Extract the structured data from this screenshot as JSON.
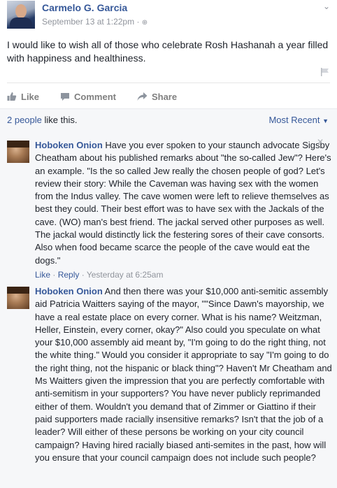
{
  "post": {
    "author": "Carmelo G. Garcia",
    "timestamp": "September 13 at 1:22pm",
    "audience_separator": "·",
    "text": "I would like to wish all of those who celebrate Rosh Hashanah a year filled with happiness and healthiness."
  },
  "actions": {
    "like": "Like",
    "comment": "Comment",
    "share": "Share"
  },
  "likes": {
    "count_text": "2 people",
    "suffix": " like this."
  },
  "sort": {
    "label": "Most Recent"
  },
  "comments": [
    {
      "author": "Hoboken Onion",
      "text": " Have you ever spoken to your staunch advocate Sigsby Cheatham about his published remarks about \"the so-called Jew\"? Here's an example. \"Is the so called Jew really the chosen people of god? Let's review their story: While the Caveman was having sex with the women from the Indus valley. The cave women were left to relieve themselves as best they could. Their best effort was to have sex with the Jackals of the cave. (WO) man's best friend. The jackal served other purposes as well. The jackal would distinctly lick the festering sores of their cave consorts. Also when food became scarce the people of the cave would eat the dogs.\"",
      "like": "Like",
      "reply": "Reply",
      "time": "Yesterday at 6:25am"
    },
    {
      "author": "Hoboken Onion",
      "text": " And then there was your $10,000 anti-semitic assembly aid Patricia Waitters saying of the mayor, \"\"Since Dawn's mayorship, we have a real estate place on every corner. What is his name? Weitzman, Heller, Einstein, every corner, okay?\" Also could you speculate on what your $10,000 assembly aid meant by, \"I'm going to do the right thing, not the white thing.\" Would you consider it appropriate to say \"I'm going to do the right thing, not the hispanic or black thing\"? Haven't Mr Cheatham and Ms Waitters given the impression that you are perfectly comfortable with anti-semitism in your supporters? You have never publicly reprimanded either of them. Wouldn't you demand that of Zimmer or Giattino if their paid supporters made racially insensitive remarks? Isn't that the job of a leader? Will either of these persons be working on your city council campaign? Having hired racially biased anti-semites in the past, how will you ensure that your council campaign does not include such people?"
    }
  ],
  "colors": {
    "link": "#365899",
    "muted": "#90949c",
    "text": "#1d2129",
    "panel": "#f6f7f9"
  }
}
